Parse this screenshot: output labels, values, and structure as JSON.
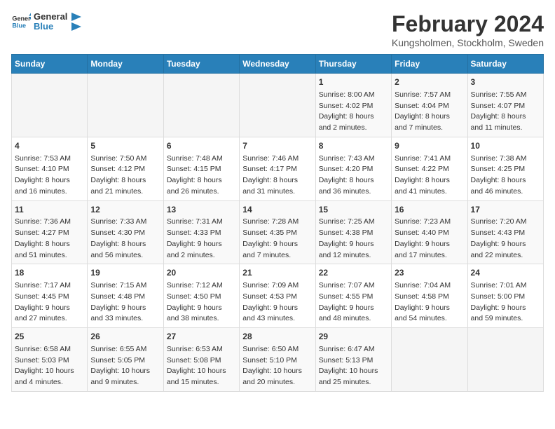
{
  "logo": {
    "text_general": "General",
    "text_blue": "Blue"
  },
  "title": "February 2024",
  "subtitle": "Kungsholmen, Stockholm, Sweden",
  "weekdays": [
    "Sunday",
    "Monday",
    "Tuesday",
    "Wednesday",
    "Thursday",
    "Friday",
    "Saturday"
  ],
  "weeks": [
    [
      {
        "day": "",
        "info": ""
      },
      {
        "day": "",
        "info": ""
      },
      {
        "day": "",
        "info": ""
      },
      {
        "day": "",
        "info": ""
      },
      {
        "day": "1",
        "info": "Sunrise: 8:00 AM\nSunset: 4:02 PM\nDaylight: 8 hours\nand 2 minutes."
      },
      {
        "day": "2",
        "info": "Sunrise: 7:57 AM\nSunset: 4:04 PM\nDaylight: 8 hours\nand 7 minutes."
      },
      {
        "day": "3",
        "info": "Sunrise: 7:55 AM\nSunset: 4:07 PM\nDaylight: 8 hours\nand 11 minutes."
      }
    ],
    [
      {
        "day": "4",
        "info": "Sunrise: 7:53 AM\nSunset: 4:10 PM\nDaylight: 8 hours\nand 16 minutes."
      },
      {
        "day": "5",
        "info": "Sunrise: 7:50 AM\nSunset: 4:12 PM\nDaylight: 8 hours\nand 21 minutes."
      },
      {
        "day": "6",
        "info": "Sunrise: 7:48 AM\nSunset: 4:15 PM\nDaylight: 8 hours\nand 26 minutes."
      },
      {
        "day": "7",
        "info": "Sunrise: 7:46 AM\nSunset: 4:17 PM\nDaylight: 8 hours\nand 31 minutes."
      },
      {
        "day": "8",
        "info": "Sunrise: 7:43 AM\nSunset: 4:20 PM\nDaylight: 8 hours\nand 36 minutes."
      },
      {
        "day": "9",
        "info": "Sunrise: 7:41 AM\nSunset: 4:22 PM\nDaylight: 8 hours\nand 41 minutes."
      },
      {
        "day": "10",
        "info": "Sunrise: 7:38 AM\nSunset: 4:25 PM\nDaylight: 8 hours\nand 46 minutes."
      }
    ],
    [
      {
        "day": "11",
        "info": "Sunrise: 7:36 AM\nSunset: 4:27 PM\nDaylight: 8 hours\nand 51 minutes."
      },
      {
        "day": "12",
        "info": "Sunrise: 7:33 AM\nSunset: 4:30 PM\nDaylight: 8 hours\nand 56 minutes."
      },
      {
        "day": "13",
        "info": "Sunrise: 7:31 AM\nSunset: 4:33 PM\nDaylight: 9 hours\nand 2 minutes."
      },
      {
        "day": "14",
        "info": "Sunrise: 7:28 AM\nSunset: 4:35 PM\nDaylight: 9 hours\nand 7 minutes."
      },
      {
        "day": "15",
        "info": "Sunrise: 7:25 AM\nSunset: 4:38 PM\nDaylight: 9 hours\nand 12 minutes."
      },
      {
        "day": "16",
        "info": "Sunrise: 7:23 AM\nSunset: 4:40 PM\nDaylight: 9 hours\nand 17 minutes."
      },
      {
        "day": "17",
        "info": "Sunrise: 7:20 AM\nSunset: 4:43 PM\nDaylight: 9 hours\nand 22 minutes."
      }
    ],
    [
      {
        "day": "18",
        "info": "Sunrise: 7:17 AM\nSunset: 4:45 PM\nDaylight: 9 hours\nand 27 minutes."
      },
      {
        "day": "19",
        "info": "Sunrise: 7:15 AM\nSunset: 4:48 PM\nDaylight: 9 hours\nand 33 minutes."
      },
      {
        "day": "20",
        "info": "Sunrise: 7:12 AM\nSunset: 4:50 PM\nDaylight: 9 hours\nand 38 minutes."
      },
      {
        "day": "21",
        "info": "Sunrise: 7:09 AM\nSunset: 4:53 PM\nDaylight: 9 hours\nand 43 minutes."
      },
      {
        "day": "22",
        "info": "Sunrise: 7:07 AM\nSunset: 4:55 PM\nDaylight: 9 hours\nand 48 minutes."
      },
      {
        "day": "23",
        "info": "Sunrise: 7:04 AM\nSunset: 4:58 PM\nDaylight: 9 hours\nand 54 minutes."
      },
      {
        "day": "24",
        "info": "Sunrise: 7:01 AM\nSunset: 5:00 PM\nDaylight: 9 hours\nand 59 minutes."
      }
    ],
    [
      {
        "day": "25",
        "info": "Sunrise: 6:58 AM\nSunset: 5:03 PM\nDaylight: 10 hours\nand 4 minutes."
      },
      {
        "day": "26",
        "info": "Sunrise: 6:55 AM\nSunset: 5:05 PM\nDaylight: 10 hours\nand 9 minutes."
      },
      {
        "day": "27",
        "info": "Sunrise: 6:53 AM\nSunset: 5:08 PM\nDaylight: 10 hours\nand 15 minutes."
      },
      {
        "day": "28",
        "info": "Sunrise: 6:50 AM\nSunset: 5:10 PM\nDaylight: 10 hours\nand 20 minutes."
      },
      {
        "day": "29",
        "info": "Sunrise: 6:47 AM\nSunset: 5:13 PM\nDaylight: 10 hours\nand 25 minutes."
      },
      {
        "day": "",
        "info": ""
      },
      {
        "day": "",
        "info": ""
      }
    ]
  ]
}
